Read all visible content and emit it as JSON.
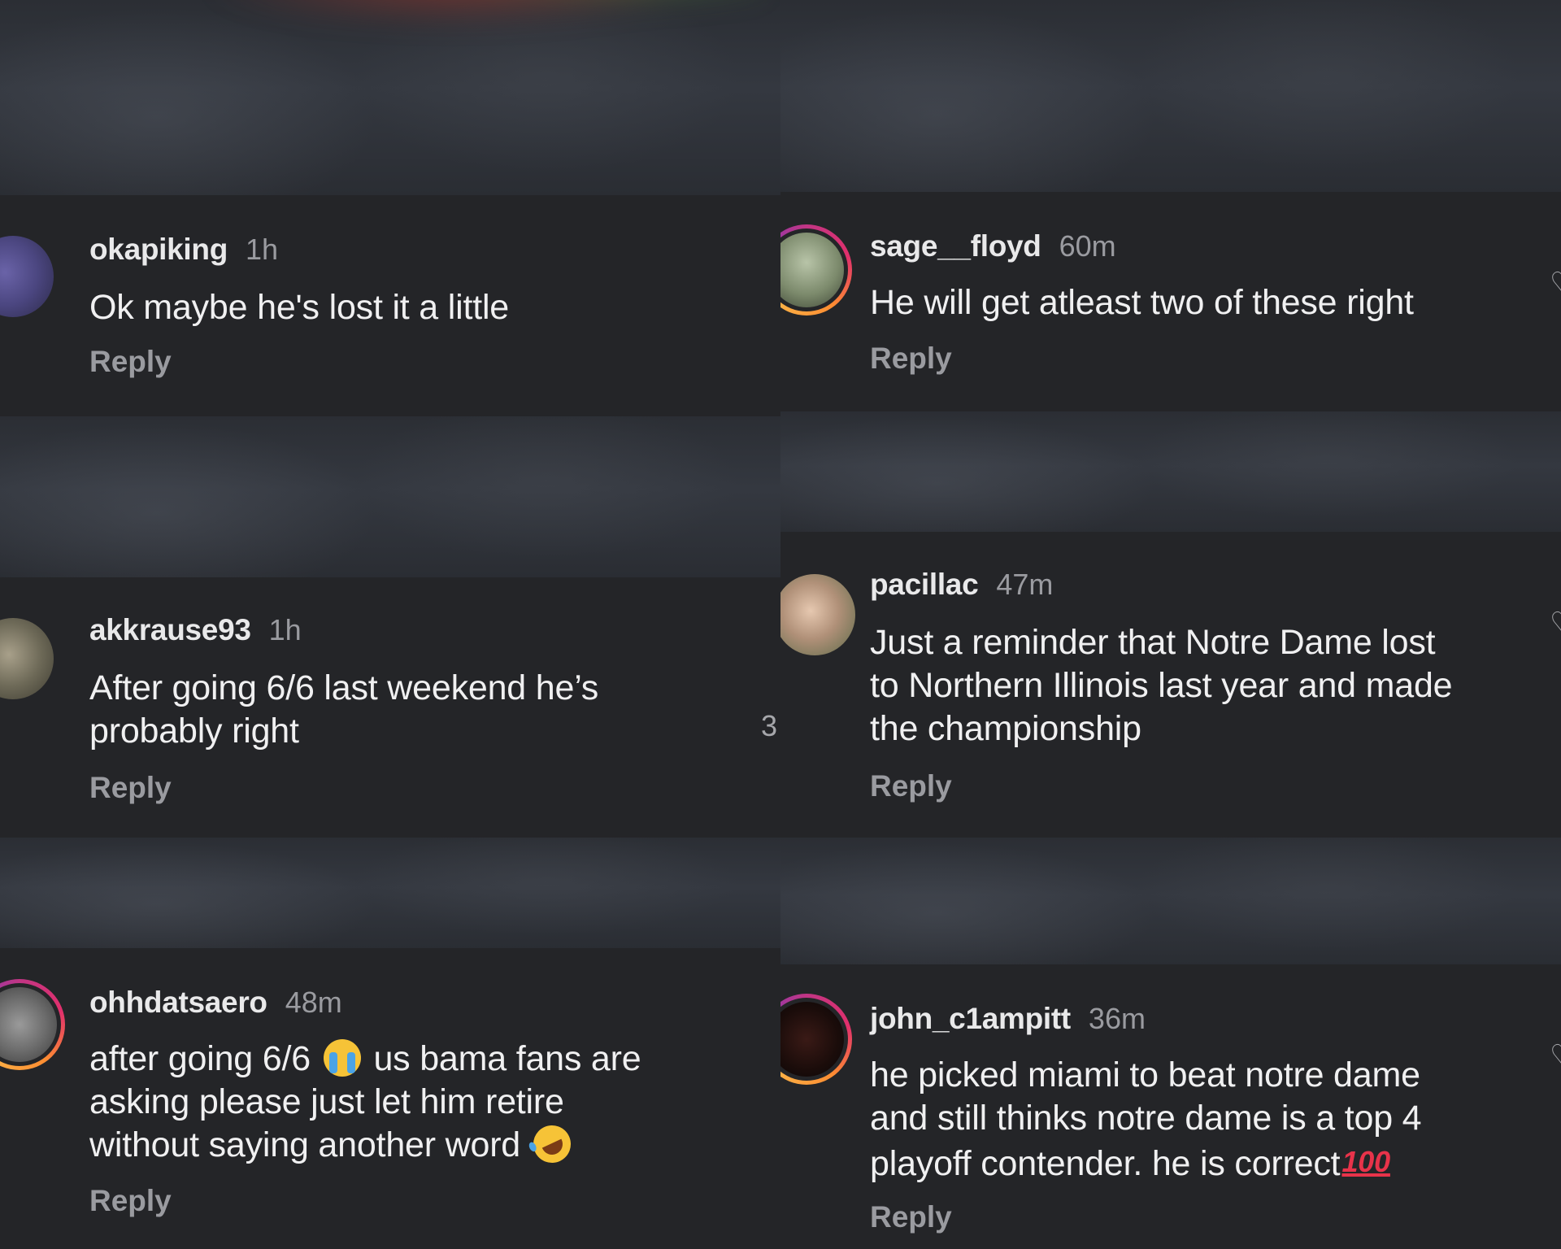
{
  "left_comments": [
    {
      "username": "okapiking",
      "time": "1h",
      "text": "Ok maybe he's lost it a little",
      "reply_label": "Reply"
    },
    {
      "username": "akkrause93",
      "time": "1h",
      "text_lines": [
        "After going 6/6 last weekend he’s",
        "probably right"
      ],
      "reply_label": "Reply"
    },
    {
      "username": "ohhdatsaero",
      "time": "48m",
      "text_line1_before": "after going 6/6",
      "text_line1_after": "us bama fans are",
      "text_line2": "asking please just let him retire",
      "text_line3": "without saying another word",
      "reply_label": "Reply"
    }
  ],
  "right_comments": [
    {
      "username": "sage__floyd",
      "time": "60m",
      "text": "He will get atleast two of these right",
      "reply_label": "Reply"
    },
    {
      "username": "pacillac",
      "time": "47m",
      "text_lines": [
        "Just a reminder that Notre Dame lost",
        "to Northern Illinois last year and made",
        "the championship"
      ],
      "reply_label": "Reply"
    },
    {
      "username": "john_c1ampitt",
      "time": "36m",
      "text_lines": [
        "he picked miami to beat notre dame",
        "and still thinks notre dame is a top 4"
      ],
      "text_line3": "playoff contender. he is correct",
      "hundred_emoji": "100",
      "reply_label": "Reply"
    }
  ],
  "side_counts": {
    "left_like_count": "3"
  },
  "emoji": {
    "crying": "loudly-crying-face",
    "laughing": "rolling-on-floor-laughing",
    "hundred": "hundred-points"
  },
  "colors": {
    "background": "#242528",
    "username": "#e9e9ea",
    "muted": "#9a9ba0",
    "story_ring": "#c13584"
  }
}
